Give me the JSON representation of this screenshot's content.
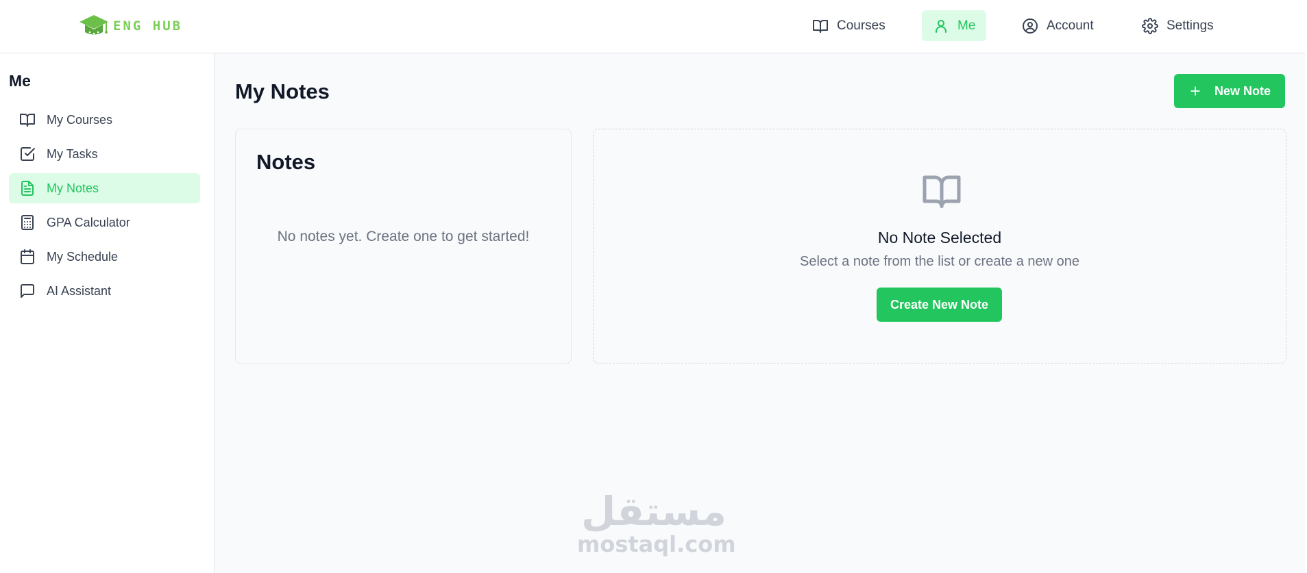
{
  "app": {
    "logo_text": "ENG HUB",
    "accent_color": "#22c55e",
    "logo_color": "#7bcf55"
  },
  "nav": {
    "items": [
      {
        "label": "Courses",
        "icon": "book-open-icon",
        "active": false
      },
      {
        "label": "Me",
        "icon": "user-icon",
        "active": true
      },
      {
        "label": "Account",
        "icon": "user-circle-icon",
        "active": false
      },
      {
        "label": "Settings",
        "icon": "gear-icon",
        "active": false
      }
    ]
  },
  "sidebar": {
    "title": "Me",
    "items": [
      {
        "label": "My Courses",
        "icon": "book-open-icon",
        "active": false
      },
      {
        "label": "My Tasks",
        "icon": "checkbox-icon",
        "active": false
      },
      {
        "label": "My Notes",
        "icon": "document-icon",
        "active": true
      },
      {
        "label": "GPA Calculator",
        "icon": "calculator-icon",
        "active": false
      },
      {
        "label": "My Schedule",
        "icon": "calendar-icon",
        "active": false
      },
      {
        "label": "AI Assistant",
        "icon": "chat-icon",
        "active": false
      }
    ]
  },
  "main": {
    "title": "My Notes",
    "new_note_label": "New Note",
    "notes_panel": {
      "title": "Notes",
      "empty_text": "No notes yet. Create one to get started!"
    },
    "detail_panel": {
      "icon": "book-open-icon",
      "heading": "No Note Selected",
      "subtext": "Select a note from the list or create a new one",
      "button_label": "Create New Note"
    }
  },
  "watermark": {
    "arabic": "مستقل",
    "latin": "mostaql.com"
  }
}
